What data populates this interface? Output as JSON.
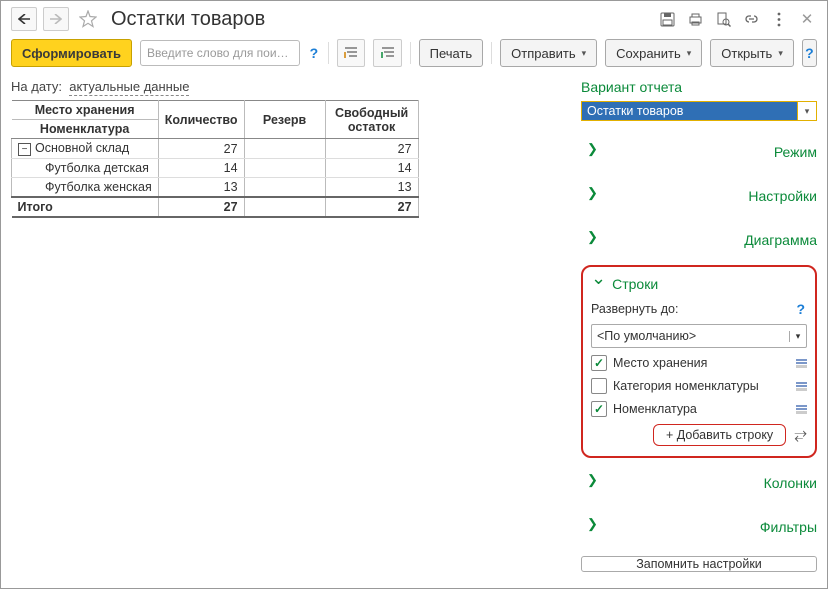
{
  "header": {
    "title": "Остатки товаров"
  },
  "toolbar": {
    "generate": "Сформировать",
    "search_placeholder": "Введите слово для пои…",
    "print": "Печать",
    "send": "Отправить",
    "save": "Сохранить",
    "open": "Открыть"
  },
  "filter": {
    "label": "На дату:",
    "value": "актуальные данные"
  },
  "table": {
    "header_group": "Место хранения",
    "header_item": "Номенклатура",
    "col_qty": "Количество",
    "col_reserve": "Резерв",
    "col_free": "Свободный остаток",
    "rows": [
      {
        "label": "Основной склад",
        "qty": 27,
        "reserve": "",
        "free": 27,
        "level": 0
      },
      {
        "label": "Футболка детская",
        "qty": 14,
        "reserve": "",
        "free": 14,
        "level": 1
      },
      {
        "label": "Футболка женская",
        "qty": 13,
        "reserve": "",
        "free": 13,
        "level": 1
      }
    ],
    "total_label": "Итого",
    "total_qty": 27,
    "total_reserve": "",
    "total_free": 27
  },
  "panel": {
    "variant_label": "Вариант отчета",
    "variant_value": "Остатки товаров",
    "mode": "Режим",
    "settings": "Настройки",
    "diagram": "Диаграмма",
    "rows_title": "Строки",
    "expand_label": "Развернуть до:",
    "expand_value": "<По умолчанию>",
    "chk1": "Место хранения",
    "chk2": "Категория номенклатуры",
    "chk3": "Номенклатура",
    "add_row": "+ Добавить строку",
    "columns": "Колонки",
    "filters": "Фильтры",
    "remember": "Запомнить настройки"
  }
}
